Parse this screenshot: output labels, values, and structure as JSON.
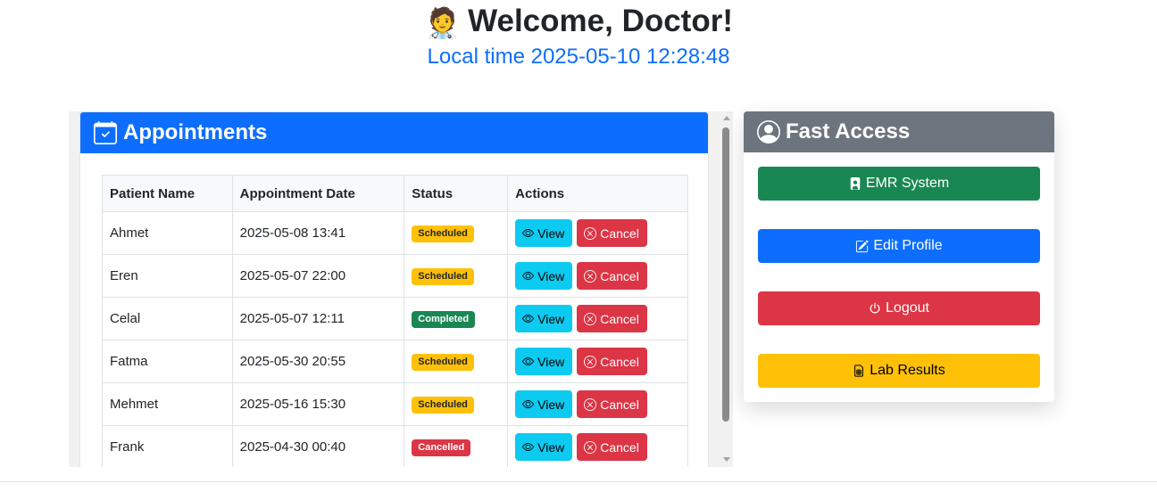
{
  "header": {
    "emoji": "🧑‍⚕️",
    "welcome": "Welcome, Doctor!",
    "local_time": "Local time 2025-05-10 12:28:48"
  },
  "appointments": {
    "title": "Appointments",
    "columns": [
      "Patient Name",
      "Appointment Date",
      "Status",
      "Actions"
    ],
    "view_label": "View",
    "cancel_label": "Cancel",
    "rows": [
      {
        "patient": "Ahmet",
        "date": "2025-05-08 13:41",
        "status": "Scheduled"
      },
      {
        "patient": "Eren",
        "date": "2025-05-07 22:00",
        "status": "Scheduled"
      },
      {
        "patient": "Celal",
        "date": "2025-05-07 12:11",
        "status": "Completed"
      },
      {
        "patient": "Fatma",
        "date": "2025-05-30 20:55",
        "status": "Scheduled"
      },
      {
        "patient": "Mehmet",
        "date": "2025-05-16 15:30",
        "status": "Scheduled"
      },
      {
        "patient": "Frank",
        "date": "2025-04-30 00:40",
        "status": "Cancelled"
      }
    ]
  },
  "fast_access": {
    "title": "Fast Access",
    "emr": "EMR System",
    "edit_profile": "Edit Profile",
    "logout": "Logout",
    "lab_results": "Lab Results"
  },
  "icons": {
    "appointments": "calendar-check-icon",
    "fast_access": "person-circle-icon",
    "view": "eye-icon",
    "cancel": "x-circle-icon",
    "emr": "person-badge-icon",
    "edit": "pencil-square-icon",
    "logout": "power-icon",
    "lab": "sim-card-icon"
  },
  "colors": {
    "primary": "#0d6efd",
    "success": "#198754",
    "danger": "#dc3545",
    "warning": "#ffc107",
    "info": "#0dcaf0",
    "secondary": "#6c757d"
  }
}
